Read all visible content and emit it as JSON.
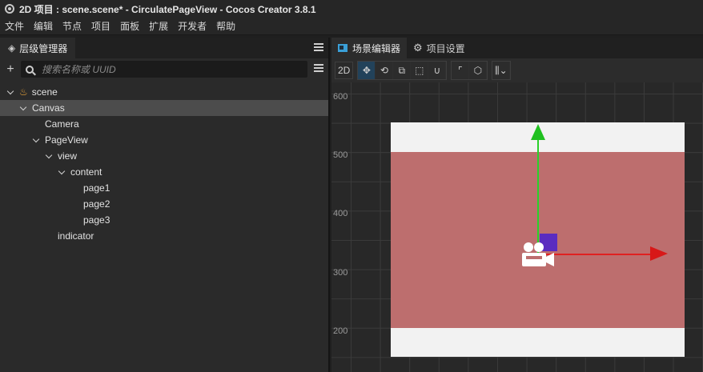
{
  "window": {
    "title": "2D 项目 : scene.scene* - CirculatePageView - Cocos Creator 3.8.1"
  },
  "menubar": {
    "items": [
      "文件",
      "编辑",
      "节点",
      "项目",
      "面板",
      "扩展",
      "开发者",
      "帮助"
    ]
  },
  "hierarchy": {
    "tab_label": "层级管理器",
    "search_placeholder": "搜索名称或 UUID",
    "nodes": [
      {
        "label": "scene",
        "depth": 0,
        "expanded": true,
        "icon": "scene-flame-icon"
      },
      {
        "label": "Canvas",
        "depth": 1,
        "expanded": true,
        "selected": true
      },
      {
        "label": "Camera",
        "depth": 2,
        "expanded": false,
        "leaf": true
      },
      {
        "label": "PageView",
        "depth": 2,
        "expanded": true
      },
      {
        "label": "view",
        "depth": 3,
        "expanded": true
      },
      {
        "label": "content",
        "depth": 4,
        "expanded": true
      },
      {
        "label": "page1",
        "depth": 5,
        "leaf": true
      },
      {
        "label": "page2",
        "depth": 5,
        "leaf": true
      },
      {
        "label": "page3",
        "depth": 5,
        "leaf": true
      },
      {
        "label": "indicator",
        "depth": 3,
        "leaf": true
      }
    ]
  },
  "scene_editor": {
    "tabs": [
      {
        "label": "场景编辑器",
        "active": true
      },
      {
        "label": "项目设置",
        "active": false
      }
    ],
    "toolbar": {
      "mode_2d": "2D"
    },
    "y_axis_labels": [
      "600",
      "500",
      "400",
      "300",
      "200"
    ],
    "colors": {
      "canvas_bg": "#f2f2f2",
      "page_red": "#bd6e6e",
      "gizmo_x": "#e02020",
      "gizmo_y": "#20c020",
      "gizmo_xy": "#5a2cc0",
      "accent": "#3aa0d8"
    }
  }
}
